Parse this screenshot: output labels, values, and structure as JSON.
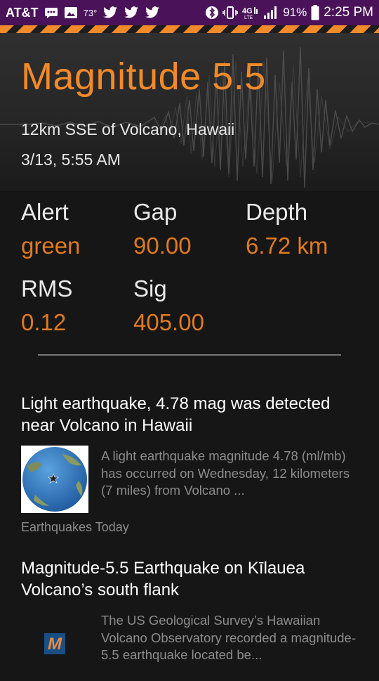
{
  "status_bar": {
    "carrier": "AT&T",
    "temperature": "73°",
    "battery": "91%",
    "time": "2:25 PM",
    "network": "4G LTE",
    "icons": [
      "messages-icon",
      "gallery-icon",
      "twitter-icon",
      "twitter-icon",
      "twitter-icon",
      "bluetooth-icon",
      "vibrate-icon",
      "lte-icon",
      "signal-icon",
      "battery-icon"
    ]
  },
  "quake": {
    "title": "Magnitude 5.5",
    "location": "12km SSE of Volcano, Hawaii",
    "datetime": "3/13, 5:55 AM"
  },
  "stats": {
    "alert": {
      "label": "Alert",
      "value": "green"
    },
    "gap": {
      "label": "Gap",
      "value": "90.00"
    },
    "depth": {
      "label": "Depth",
      "value": "6.72 km"
    },
    "rms": {
      "label": "RMS",
      "value": "0.12"
    },
    "sig": {
      "label": "Sig",
      "value": "405.00"
    }
  },
  "news": [
    {
      "title": "Light earthquake, 4.78 mag was detected near Volcano in Hawaii",
      "snippet": "A light earthquake magnitude 4.78 (ml/mb) has occurred on Wednesday, 12 kilometers (7 miles) from Volcano ...",
      "source": "Earthquakes Today",
      "thumbnail": "globe-map-icon"
    },
    {
      "title": "Magnitude-5.5 Earthquake on Kīlauea Volcano’s south flank",
      "snippet": "The US Geological Survey’s Hawaiian Volcano Observatory recorded a magnitude-5.5 earthquake located be...",
      "thumbnail": "publisher-logo-icon"
    }
  ],
  "colors": {
    "accent": "#f28a2a",
    "value": "#e07a1e",
    "status_bar": "#4a1258",
    "background": "#161616"
  }
}
